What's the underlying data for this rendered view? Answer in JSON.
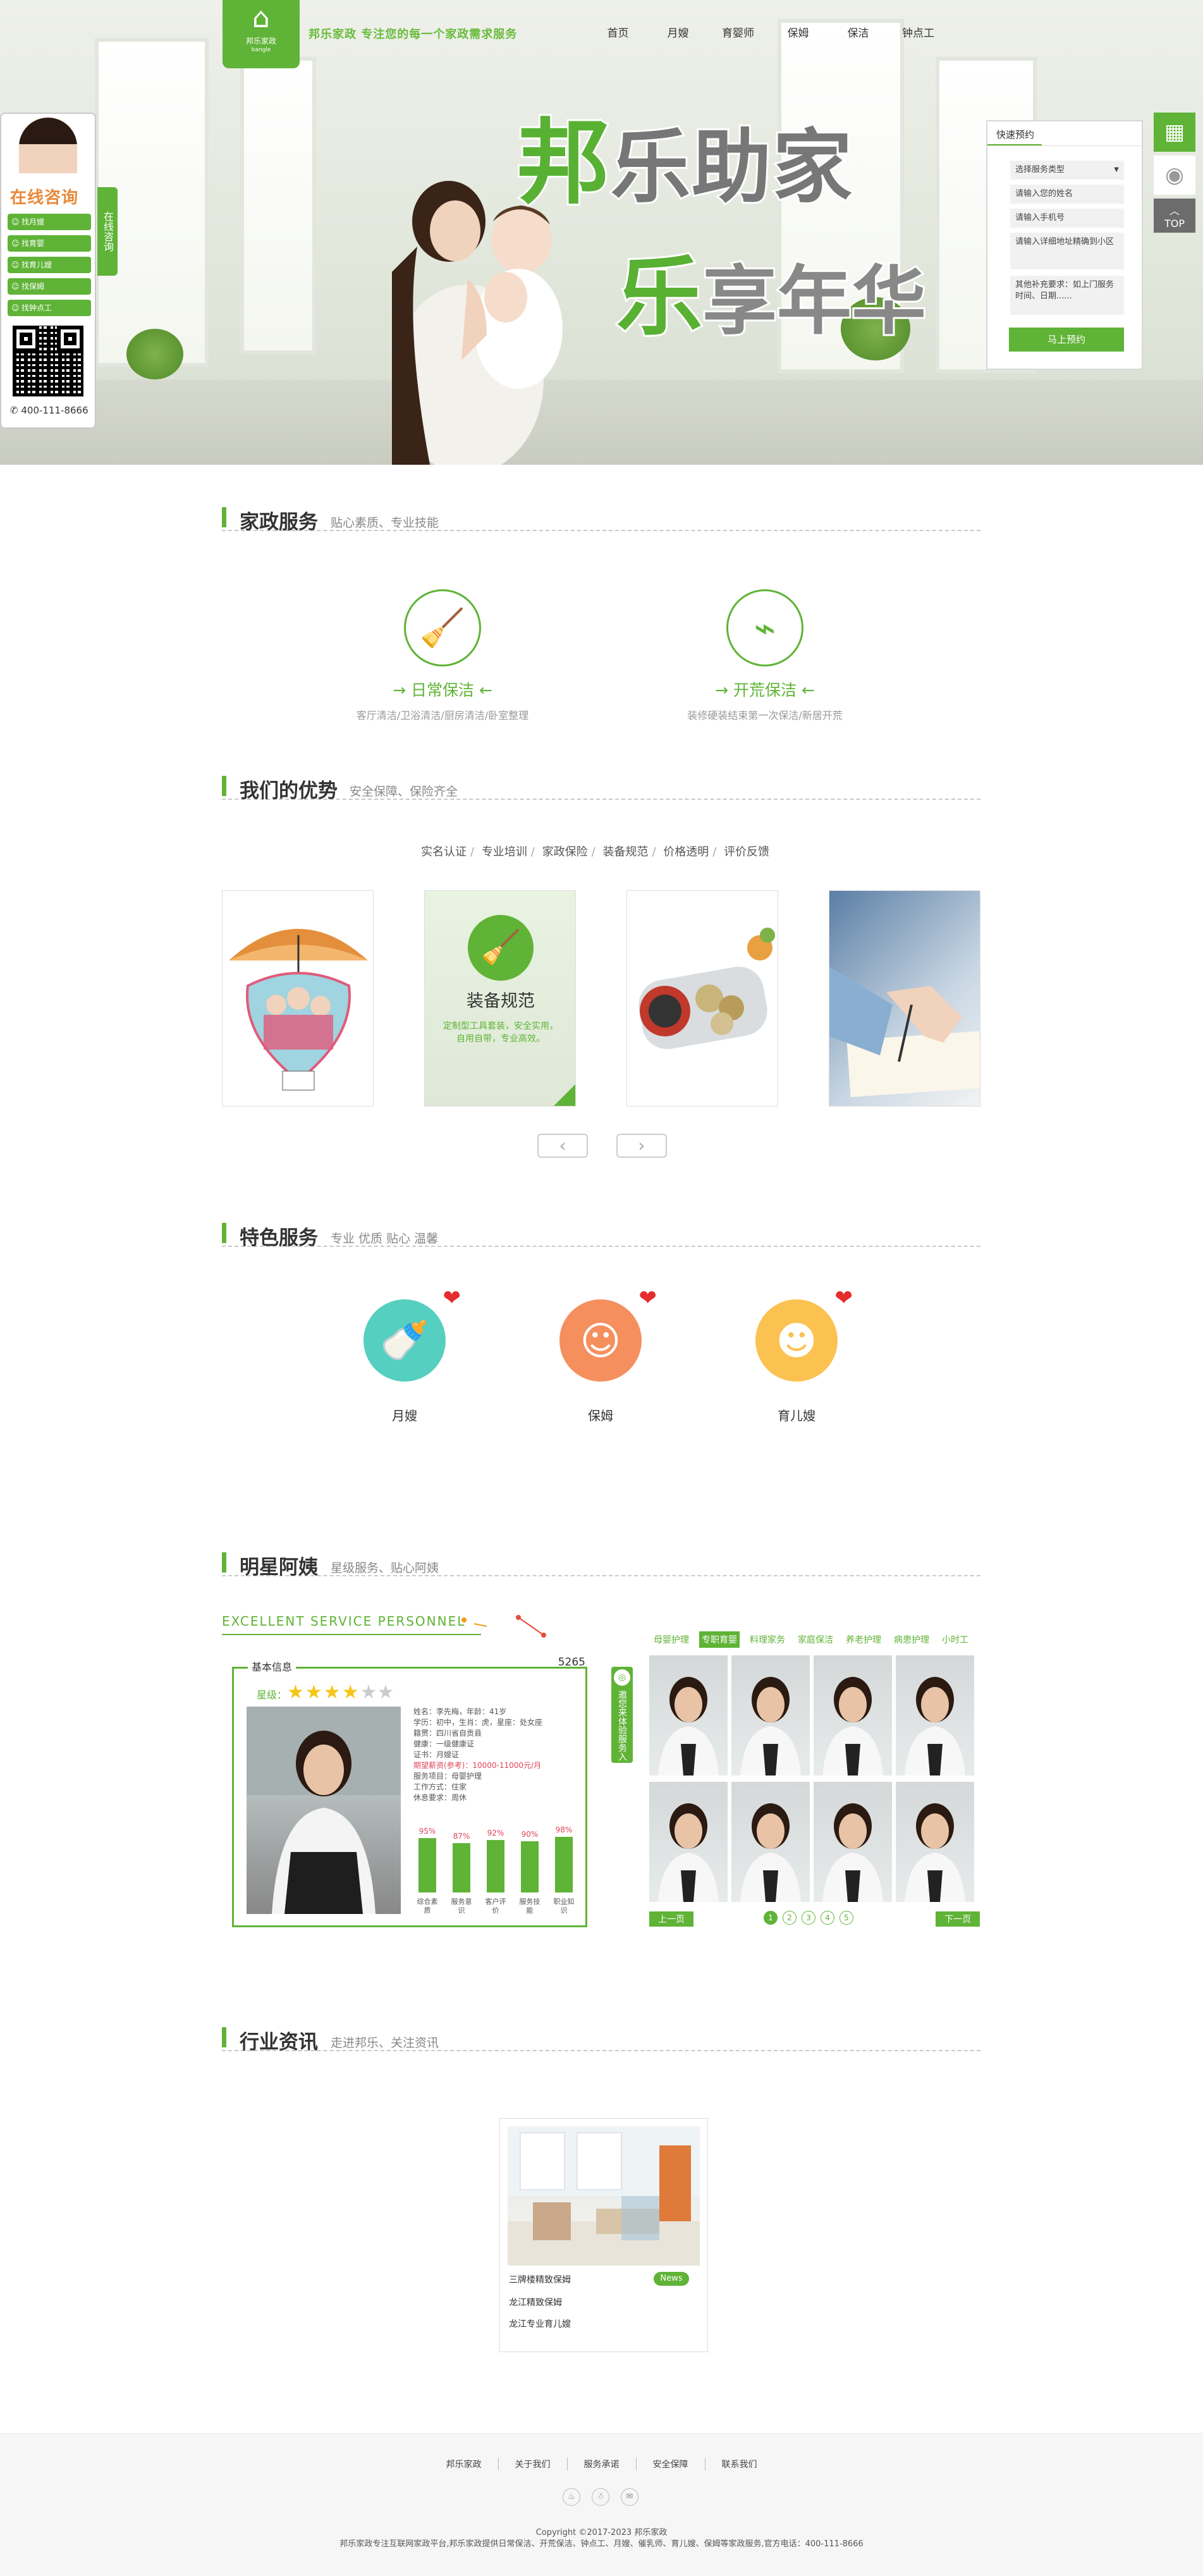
{
  "header": {
    "logo_name": "邦乐家政",
    "logo_sub": "bangle",
    "slogan": "邦乐家政 专注您的每一个家政需求服务",
    "nav": [
      "首页",
      "月嫂",
      "育婴师",
      "保姆",
      "保洁",
      "钟点工"
    ]
  },
  "hero": {
    "title1_green": "邦",
    "title1_rest": "乐助家",
    "title2_green": "乐",
    "title2_rest": "享年华"
  },
  "consult": {
    "title": "在线咨询",
    "tab": "在线咨询",
    "buttons": [
      "找月嫂",
      "找育婴",
      "找育儿嫂",
      "找保姆",
      "找钟点工"
    ],
    "phone": "400-111-8666"
  },
  "booking": {
    "title": "快速预约",
    "service_select": "选择服务类型",
    "name_placeholder": "请输入您的姓名",
    "phone_placeholder": "请输入手机号",
    "address_placeholder": "请输入详细地址精确到小区",
    "note_placeholder": "其他补充要求：如上门服务时间、日期......",
    "submit": "马上预约"
  },
  "rside": {
    "top_label": "TOP",
    "top_arrow": "︿"
  },
  "sections": {
    "service": {
      "title": "家政服务",
      "sub": "贴心素质、专业技能"
    },
    "advantage": {
      "title": "我们的优势",
      "sub": "安全保障、保险齐全"
    },
    "feature": {
      "title": "特色服务",
      "sub": "专业 优质 贴心 温馨"
    },
    "star": {
      "title": "明星阿姨",
      "sub": "星级服务、贴心阿姨"
    },
    "news": {
      "title": "行业资讯",
      "sub": "走进邦乐、关注资讯"
    }
  },
  "services": [
    {
      "name": "日常保洁",
      "desc": "客厅清洁/卫浴清洁/厨房清洁/卧室整理"
    },
    {
      "name": "开荒保洁",
      "desc": "装修硬装结束第一次保洁/新居开荒"
    }
  ],
  "advantage_tabs": [
    "实名认证",
    "专业培训",
    "家政保险",
    "装备规范",
    "价格透明",
    "评价反馈"
  ],
  "advantage_card": {
    "title": "装备规范",
    "text": "定制型工具套装，安全实用，自用自带，专业高效。"
  },
  "arrows": {
    "prev": "‹",
    "next": "›"
  },
  "features": [
    "月嫂",
    "保姆",
    "育儿嫂"
  ],
  "star": {
    "eng_title": "EXCELLENT SERVICE PERSONNEL",
    "header": "基本信息",
    "id_number": "5265",
    "star_label": "星级：",
    "stars_filled": "★★★★",
    "stars_empty": "★★",
    "info": [
      "姓名：李先梅，年龄：41岁",
      "学历：初中，生肖：虎，星座：处女座",
      "籍贯：四川省自贡县",
      "健康：一级健康证",
      "证书：月嫂证",
      "期望薪资(参考)：10000-11000元/月",
      "服务项目：母婴护理",
      "工作方式：住家",
      "休息要求：周休"
    ],
    "bars": [
      {
        "pct": "95%",
        "label": "综合素质"
      },
      {
        "pct": "87%",
        "label": "服务意识"
      },
      {
        "pct": "92%",
        "label": "客户评价"
      },
      {
        "pct": "90%",
        "label": "服务技能"
      },
      {
        "pct": "98%",
        "label": "职业知识"
      }
    ],
    "vtab": "邀您来体验服务入口",
    "categories": [
      "母婴护理",
      "专职育婴",
      "料理家务",
      "家庭保洁",
      "养老护理",
      "病患护理",
      "小时工"
    ],
    "active_category": 1,
    "prev": "上一页",
    "next": "下一页",
    "pages": [
      "1",
      "2",
      "3",
      "4",
      "5"
    ]
  },
  "news": {
    "items": [
      "三牌楼精致保姆",
      "龙江精致保姆",
      "龙江专业育儿嫂"
    ],
    "tag": "News"
  },
  "footer": {
    "links": [
      "邦乐家政",
      "关于我们",
      "服务承诺",
      "安全保障",
      "联系我们"
    ],
    "icons": [
      "微博",
      "QQ",
      "邮箱"
    ],
    "copyright": "Copyright ©2017-2023 邦乐家政",
    "desc": "邦乐家政专注互联网家政平台,邦乐家政提供日常保洁、开荒保洁、钟点工、月嫂、催乳师、育儿嫂、保姆等家政服务,官方电话：400-111-8666"
  }
}
